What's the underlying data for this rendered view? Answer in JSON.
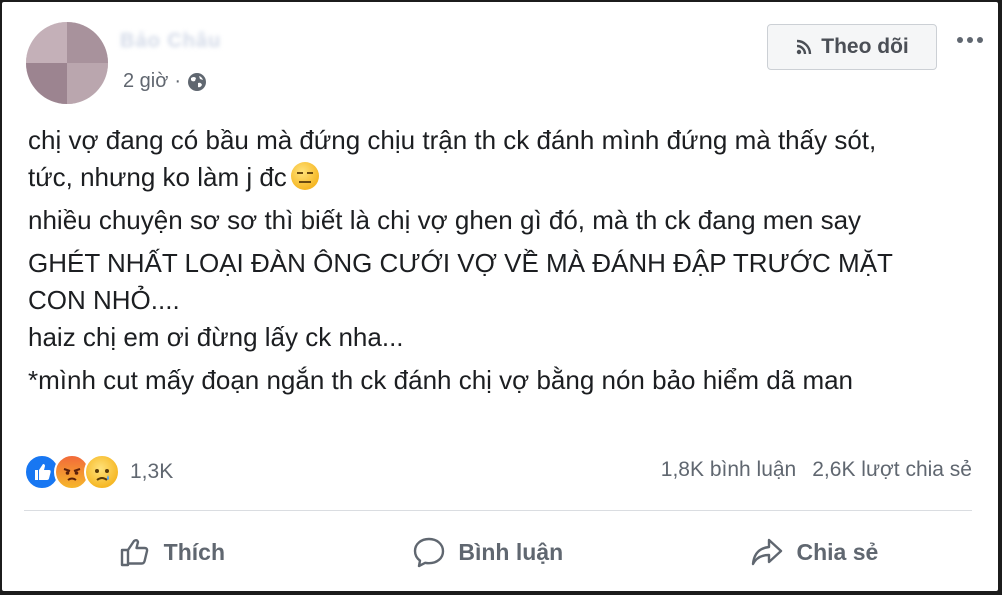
{
  "post": {
    "author_name": "Bảo Châu",
    "time": "2 giờ",
    "separator": "·",
    "follow_label": "Theo dõi",
    "lines": [
      "chị vợ đang có bầu mà đứng chịu trận th ck đánh mình đứng mà thấy sót,",
      "tức, nhưng ko làm j đc",
      "nhiều chuyện sơ sơ thì biết là chị vợ ghen gì đó, mà th ck đang men say",
      "GHÉT NHẤT LOẠI ĐÀN ÔNG CƯỚI VỢ VỀ MÀ ĐÁNH ĐẬP TRƯỚC MẶT",
      "CON NHỎ....",
      "haiz chị em ơi đừng lấy ck nha...",
      "*mình cut mấy đoạn ngắn th ck đánh chị vợ bằng nón bảo hiểm dã man"
    ]
  },
  "reactions": {
    "icons": [
      "like-icon",
      "angry-icon",
      "sad-icon"
    ],
    "count": "1,3K"
  },
  "stats": {
    "comments": "1,8K bình luận",
    "shares": "2,6K lượt chia sẻ"
  },
  "actions": {
    "like": "Thích",
    "comment": "Bình luận",
    "share": "Chia sẻ"
  },
  "colors": {
    "secondary_text": "#606770",
    "like_blue": "#1877f2"
  }
}
